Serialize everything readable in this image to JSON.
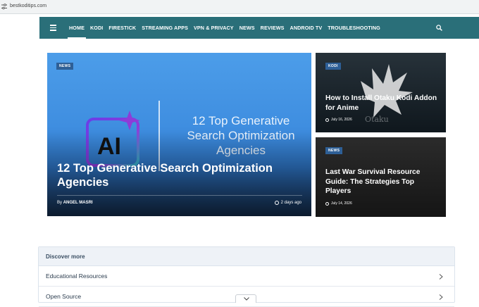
{
  "browser": {
    "url": "bestkoditips.com"
  },
  "nav": {
    "items": [
      "HOME",
      "KODI",
      "FIRESTICK",
      "STREAMING APPS",
      "VPN & PRIVACY",
      "NEWS",
      "REVIEWS",
      "ANDROID TV",
      "TROUBLESHOOTING"
    ],
    "active_index": 0
  },
  "hero": {
    "badge": "NEWS",
    "logo_text": "AI",
    "image_title": "12 Top Generative Search Optimization Agencies",
    "title": "12 Top Generative Search Optimization Agencies",
    "by_prefix": "By",
    "author": "ANGEL MASRI",
    "time": "2 days ago"
  },
  "side_cards": [
    {
      "badge": "KODI",
      "title": "How to Install Otaku Kodi Addon for Anime",
      "date": "July 16, 2026",
      "art_text": "Otaku"
    },
    {
      "badge": "NEWS",
      "title": "Last War Survival Resource Guide: The Strategies Top Players",
      "date": "July 14, 2026"
    }
  ],
  "discover": {
    "heading": "Discover more",
    "items": [
      "Educational Resources",
      "Open Source"
    ]
  },
  "colors": {
    "nav_bg": "#2a6f79",
    "badge_bg": "#2e5f96",
    "hero_blue": "#4c9de9"
  }
}
